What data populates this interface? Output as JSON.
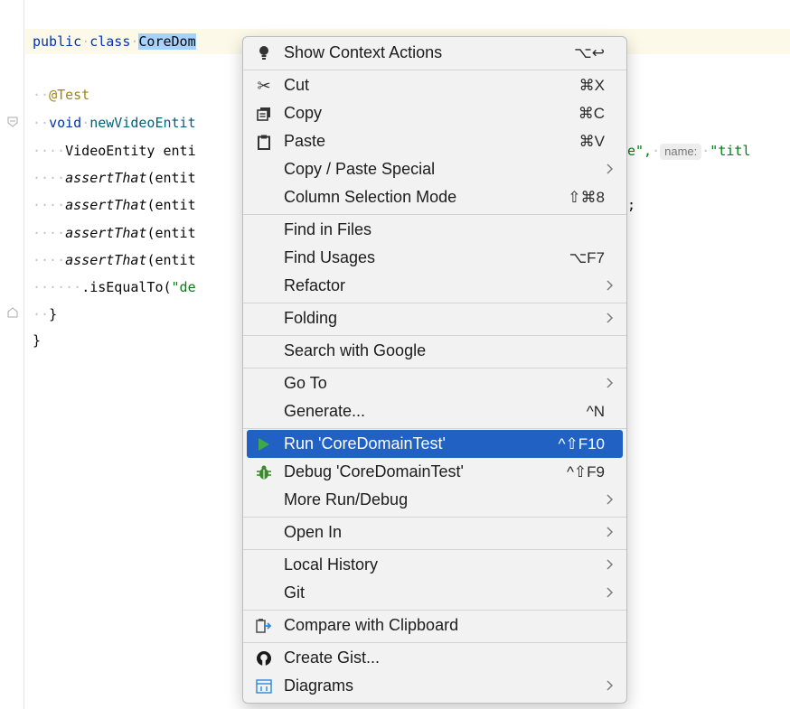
{
  "editor": {
    "line_class": {
      "kw1": "public",
      "kw2": "class",
      "cls": "CoreDom"
    },
    "line_annotation": "@Test",
    "line_method": {
      "kw": "void",
      "name": "newVideoEntit"
    },
    "line_entity": {
      "prefix": "VideoEntity enti",
      "tail": "e\",",
      "hint": "name:",
      "str": "\"titl"
    },
    "line_assert1": {
      "fn": "assertThat",
      "rest": "(entit"
    },
    "line_assert2": {
      "fn": "assertThat",
      "rest": "(entit"
    },
    "line_assert3": {
      "fn": "assertThat",
      "rest": "(entit",
      "tail": ";"
    },
    "line_assert4": {
      "fn": "assertThat",
      "rest": "(entit"
    },
    "line_isequal": {
      "prefix": ".isEqualTo(",
      "str": "\"de"
    },
    "line_close_inner": "}",
    "line_close_outer": "}"
  },
  "menu": {
    "items": [
      {
        "label": "Show Context Actions",
        "shortcut": "⌥↩",
        "icon": "lightbulb-icon"
      },
      {
        "label": "Cut",
        "shortcut": "⌘X",
        "icon": "scissors-icon"
      },
      {
        "label": "Copy",
        "shortcut": "⌘C",
        "icon": "copy-icon"
      },
      {
        "label": "Paste",
        "shortcut": "⌘V",
        "icon": "clipboard-icon"
      },
      {
        "label": "Copy / Paste Special",
        "submenu": true
      },
      {
        "label": "Column Selection Mode",
        "shortcut": "⇧⌘8"
      },
      {
        "label": "Find in Files"
      },
      {
        "label": "Find Usages",
        "shortcut": "⌥F7"
      },
      {
        "label": "Refactor",
        "submenu": true
      },
      {
        "label": "Folding",
        "submenu": true
      },
      {
        "label": "Search with Google"
      },
      {
        "label": "Go To",
        "submenu": true
      },
      {
        "label": "Generate...",
        "shortcut": "^N"
      },
      {
        "label": "Run 'CoreDomainTest'",
        "shortcut": "^⇧F10",
        "icon": "run-icon",
        "selected": true
      },
      {
        "label": "Debug 'CoreDomainTest'",
        "shortcut": "^⇧F9",
        "icon": "bug-icon"
      },
      {
        "label": "More Run/Debug",
        "submenu": true
      },
      {
        "label": "Open In",
        "submenu": true
      },
      {
        "label": "Local History",
        "submenu": true
      },
      {
        "label": "Git",
        "submenu": true
      },
      {
        "label": "Compare with Clipboard",
        "icon": "compare-icon"
      },
      {
        "label": "Create Gist...",
        "icon": "github-icon"
      },
      {
        "label": "Diagrams",
        "submenu": true,
        "icon": "diagram-icon"
      }
    ]
  },
  "colors": {
    "selection_accent": "#2161c4",
    "run_green": "#3daa4a",
    "keyword_blue": "#0033b3",
    "string_green": "#067d17"
  }
}
